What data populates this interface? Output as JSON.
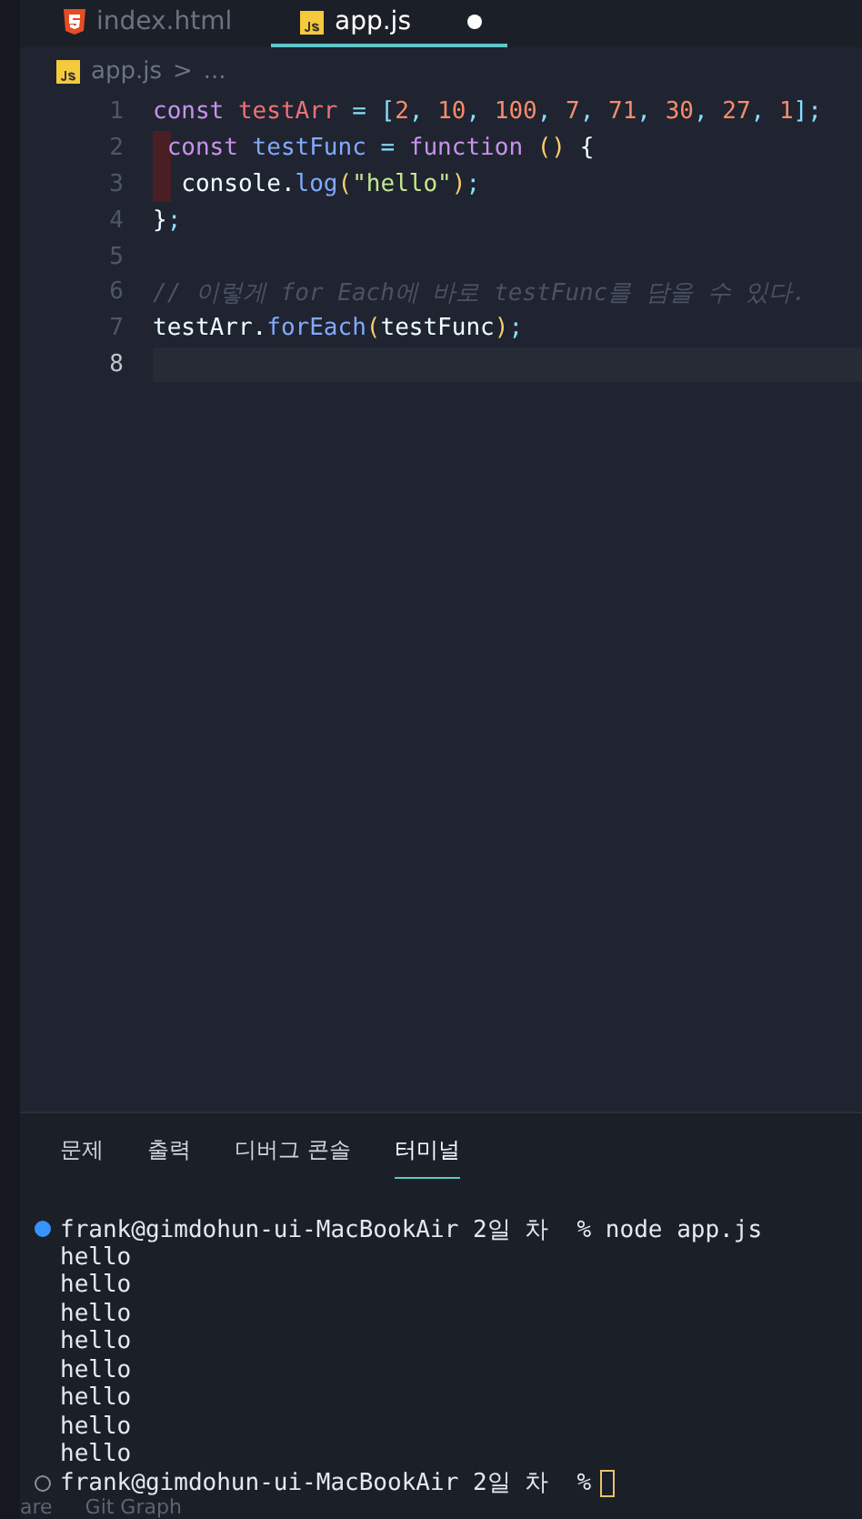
{
  "tabs": [
    {
      "label": "index.html",
      "kind": "html",
      "selected": false,
      "modified": false
    },
    {
      "label": "app.js",
      "kind": "js",
      "selected": true,
      "modified": true
    }
  ],
  "breadcrumb": {
    "file": "app.js",
    "separator": ">",
    "rest": "..."
  },
  "code_lines": [
    {
      "number": "1",
      "current": false,
      "error_mark": false,
      "tokens": [
        {
          "kind": "kw",
          "text": "const "
        },
        {
          "kind": "var",
          "text": "testArr"
        },
        {
          "kind": "punct",
          "text": " = ["
        },
        {
          "kind": "num",
          "text": "2"
        },
        {
          "kind": "punct",
          "text": ", "
        },
        {
          "kind": "num",
          "text": "10"
        },
        {
          "kind": "punct",
          "text": ", "
        },
        {
          "kind": "num",
          "text": "100"
        },
        {
          "kind": "punct",
          "text": ", "
        },
        {
          "kind": "num",
          "text": "7"
        },
        {
          "kind": "punct",
          "text": ", "
        },
        {
          "kind": "num",
          "text": "71"
        },
        {
          "kind": "punct",
          "text": ", "
        },
        {
          "kind": "num",
          "text": "30"
        },
        {
          "kind": "punct",
          "text": ", "
        },
        {
          "kind": "num",
          "text": "27"
        },
        {
          "kind": "punct",
          "text": ", "
        },
        {
          "kind": "num",
          "text": "1"
        },
        {
          "kind": "punct",
          "text": "];"
        }
      ]
    },
    {
      "number": "2",
      "current": false,
      "error_mark": true,
      "tokens": [
        {
          "kind": "kw",
          "text": " const "
        },
        {
          "kind": "fn",
          "text": "testFunc"
        },
        {
          "kind": "punct",
          "text": " = "
        },
        {
          "kind": "kw",
          "text": "function "
        },
        {
          "kind": "paren",
          "text": "() "
        },
        {
          "kind": "plain",
          "text": "{"
        }
      ]
    },
    {
      "number": "3",
      "current": false,
      "error_mark": true,
      "tokens": [
        {
          "kind": "plain",
          "text": "  console."
        },
        {
          "kind": "fn",
          "text": "log"
        },
        {
          "kind": "paren",
          "text": "("
        },
        {
          "kind": "str",
          "text": "\"hello\""
        },
        {
          "kind": "paren",
          "text": ")"
        },
        {
          "kind": "punct",
          "text": ";"
        }
      ]
    },
    {
      "number": "4",
      "current": false,
      "error_mark": false,
      "tokens": [
        {
          "kind": "plain",
          "text": "}"
        },
        {
          "kind": "punct",
          "text": ";"
        }
      ]
    },
    {
      "number": "5",
      "current": false,
      "error_mark": false
    },
    {
      "number": "6",
      "current": false,
      "error_mark": false,
      "tokens": [
        {
          "kind": "comment",
          "text": "// 이렇게 for Each에 바로 testFunc를 담을 수 있다."
        }
      ]
    },
    {
      "number": "7",
      "current": false,
      "error_mark": false,
      "tokens": [
        {
          "kind": "plain",
          "text": "testArr."
        },
        {
          "kind": "fn",
          "text": "forEach"
        },
        {
          "kind": "paren",
          "text": "("
        },
        {
          "kind": "plain",
          "text": "testFunc"
        },
        {
          "kind": "paren",
          "text": ")"
        },
        {
          "kind": "punct",
          "text": ";"
        }
      ]
    },
    {
      "number": "8",
      "current": true,
      "error_mark": false
    }
  ],
  "panel_tabs": [
    {
      "label": "문제",
      "selected": false
    },
    {
      "label": "출력",
      "selected": false
    },
    {
      "label": "디버그 콘솔",
      "selected": false
    },
    {
      "label": "터미널",
      "selected": true
    }
  ],
  "terminal_lines": [
    {
      "kind": "prompt",
      "text": "frank@gimdohun-ui-MacBookAir 2일 차  % node app.js",
      "finished": true
    },
    {
      "kind": "output",
      "text": "hello"
    },
    {
      "kind": "output",
      "text": "hello"
    },
    {
      "kind": "output",
      "text": "hello"
    },
    {
      "kind": "output",
      "text": "hello"
    },
    {
      "kind": "output",
      "text": "hello"
    },
    {
      "kind": "output",
      "text": "hello"
    },
    {
      "kind": "output",
      "text": "hello"
    },
    {
      "kind": "output",
      "text": "hello"
    },
    {
      "kind": "prompt",
      "text": "frank@gimdohun-ui-MacBookAir 2일 차  %",
      "finished": false,
      "cursor": true
    }
  ],
  "status_bar": [
    "are",
    "Git Graph"
  ]
}
